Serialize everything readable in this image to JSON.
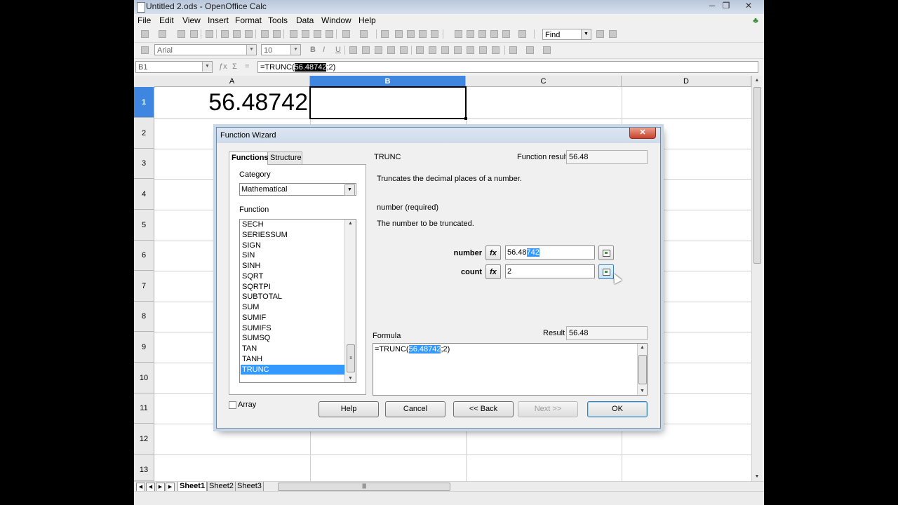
{
  "window": {
    "title": "Untitled 2.ods - OpenOffice Calc",
    "controls": {
      "minimize": "─",
      "maximize": "❐",
      "close": "✕"
    }
  },
  "menu": [
    "File",
    "Edit",
    "View",
    "Insert",
    "Format",
    "Tools",
    "Data",
    "Window",
    "Help"
  ],
  "toolbar": {
    "find_placeholder": "Find",
    "font_name": "Arial",
    "font_size": "10"
  },
  "formula_bar": {
    "name_box": "B1",
    "formula_prefix": "=TRUNC(",
    "formula_selected": "56.48742",
    "formula_suffix": ";2)"
  },
  "sheet": {
    "columns": [
      "A",
      "B",
      "C",
      "D"
    ],
    "selected_column": "B",
    "rows": [
      "1",
      "2",
      "3",
      "4",
      "5",
      "6",
      "7",
      "8",
      "9",
      "10",
      "11",
      "12",
      "13"
    ],
    "selected_row": "1",
    "cell_A1": "56.48742",
    "tabs": [
      "Sheet1",
      "Sheet2",
      "Sheet3"
    ],
    "active_tab": "Sheet1"
  },
  "dialog": {
    "title": "Function Wizard",
    "close": "✕",
    "tabs": [
      "Functions",
      "Structure"
    ],
    "category_label": "Category",
    "category_value": "Mathematical",
    "function_label": "Function",
    "functions": [
      "SECH",
      "SERIESSUM",
      "SIGN",
      "SIN",
      "SINH",
      "SQRT",
      "SQRTPI",
      "SUBTOTAL",
      "SUM",
      "SUMIF",
      "SUMIFS",
      "SUMSQ",
      "TAN",
      "TANH",
      "TRUNC"
    ],
    "selected_function": "TRUNC",
    "array_label": "Array",
    "function_name": "TRUNC",
    "function_result_label": "Function result",
    "function_result": "56.48",
    "description": "Truncates the decimal places of a number.",
    "param_title": "number (required)",
    "param_description": "The number to be truncated.",
    "args": [
      {
        "label": "number",
        "value_plain": "56.48",
        "value_selected": "742"
      },
      {
        "label": "count",
        "value_plain": "2",
        "value_selected": ""
      }
    ],
    "fx_glyph": "fx",
    "formula_label": "Formula",
    "result_label": "Result",
    "result": "56.48",
    "formula_prefix": "=TRUNC(",
    "formula_selected": "56.48742",
    "formula_suffix": ";2)",
    "buttons": {
      "help": "Help",
      "cancel": "Cancel",
      "back": "<< Back",
      "next": "Next >>",
      "ok": "OK"
    }
  }
}
